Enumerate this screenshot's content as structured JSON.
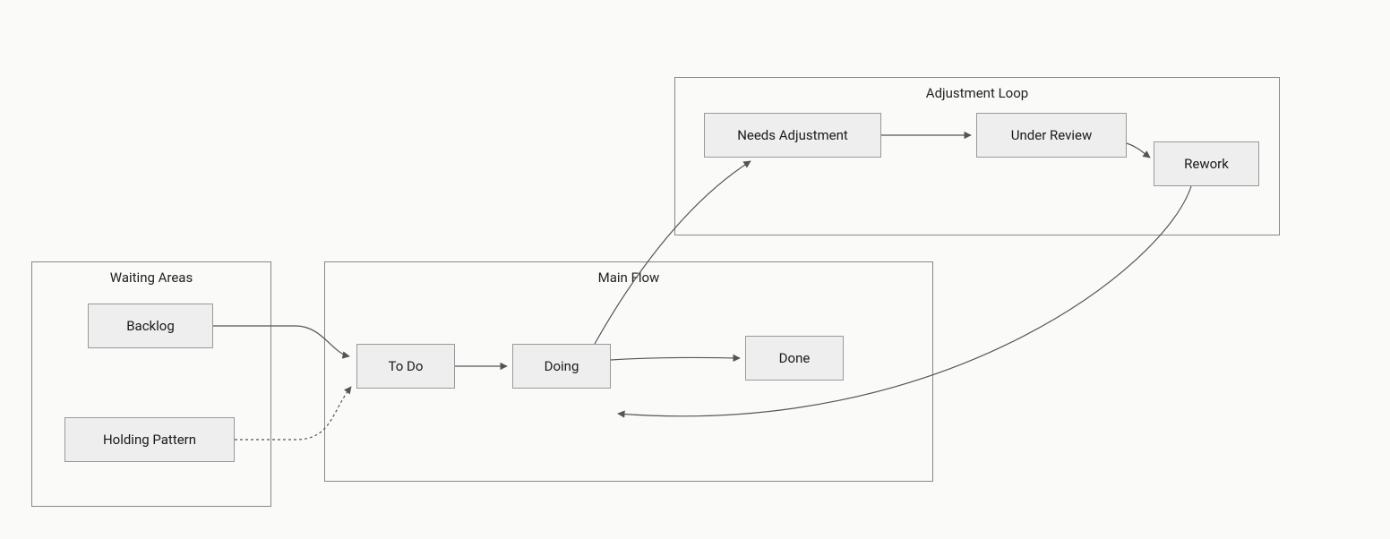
{
  "groups": {
    "waiting": {
      "title": "Waiting Areas"
    },
    "main": {
      "title": "Main Flow"
    },
    "adjust": {
      "title": "Adjustment Loop"
    }
  },
  "nodes": {
    "backlog": {
      "label": "Backlog"
    },
    "holding": {
      "label": "Holding Pattern"
    },
    "todo": {
      "label": "To Do"
    },
    "doing": {
      "label": "Doing"
    },
    "done": {
      "label": "Done"
    },
    "needsadj": {
      "label": "Needs Adjustment"
    },
    "review": {
      "label": "Under Review"
    },
    "rework": {
      "label": "Rework"
    }
  }
}
